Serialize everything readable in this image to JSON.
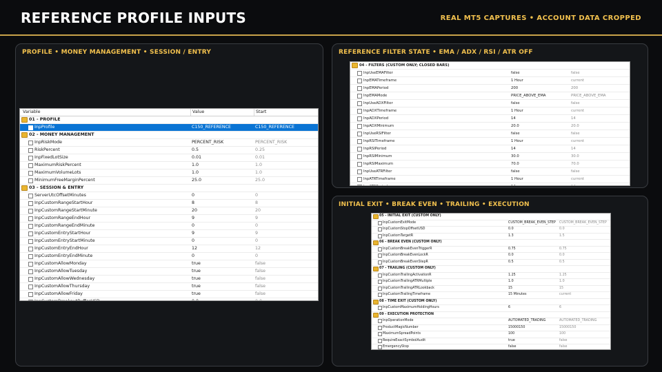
{
  "header": {
    "title": "REFERENCE PROFILE INPUTS",
    "subtitle": "REAL MT5 CAPTURES • ACCOUNT DATA CROPPED"
  },
  "cards": {
    "left_title": "PROFILE • MONEY MANAGEMENT • SESSION / ENTRY",
    "top_right_title": "REFERENCE FILTER STATE • EMA / ADX / RSI / ATR OFF",
    "bottom_right_title": "INITIAL EXIT • BREAK EVEN • TRAILING • EXECUTION"
  },
  "table_left": {
    "headers": [
      "Variable",
      "Value",
      "Start"
    ],
    "rows": [
      {
        "t": "g",
        "n": "01 - PROFILE"
      },
      {
        "t": "r",
        "n": "InpProfile",
        "v": "C150_REFERENCE",
        "s": "C150_REFERENCE",
        "sel": true
      },
      {
        "t": "g",
        "n": "02 - MONEY MANAGEMENT"
      },
      {
        "t": "r",
        "n": "InpRiskMode",
        "v": "PERCENT_RISK",
        "s": "PERCENT_RISK"
      },
      {
        "t": "r",
        "n": "RiskPercent",
        "v": "0.5",
        "s": "0.25"
      },
      {
        "t": "r",
        "n": "InpFixedLotSize",
        "v": "0.01",
        "s": "0.01"
      },
      {
        "t": "r",
        "n": "MaximumRiskPercent",
        "v": "1.0",
        "s": "1.0"
      },
      {
        "t": "r",
        "n": "MaximumVolumeLots",
        "v": "1.0",
        "s": "1.0"
      },
      {
        "t": "r",
        "n": "MinimumFreeMarginPercent",
        "v": "25.0",
        "s": "25.0"
      },
      {
        "t": "g",
        "n": "03 - SESSION & ENTRY"
      },
      {
        "t": "r",
        "n": "ServerUtcOffsetMinutes",
        "v": "0",
        "s": "0"
      },
      {
        "t": "r",
        "n": "InpCustomRangeStartHour",
        "v": "8",
        "s": "8"
      },
      {
        "t": "r",
        "n": "InpCustomRangeStartMinute",
        "v": "20",
        "s": "20"
      },
      {
        "t": "r",
        "n": "InpCustomRangeEndHour",
        "v": "9",
        "s": "9"
      },
      {
        "t": "r",
        "n": "InpCustomRangeEndMinute",
        "v": "0",
        "s": "0"
      },
      {
        "t": "r",
        "n": "InpCustomEntryStartHour",
        "v": "9",
        "s": "9"
      },
      {
        "t": "r",
        "n": "InpCustomEntryStartMinute",
        "v": "0",
        "s": "0"
      },
      {
        "t": "r",
        "n": "InpCustomEntryEndHour",
        "v": "12",
        "s": "12"
      },
      {
        "t": "r",
        "n": "InpCustomEntryEndMinute",
        "v": "0",
        "s": "0"
      },
      {
        "t": "r",
        "n": "InpCustomAllowMonday",
        "v": "true",
        "s": "false"
      },
      {
        "t": "r",
        "n": "InpCustomAllowTuesday",
        "v": "true",
        "s": "false"
      },
      {
        "t": "r",
        "n": "InpCustomAllowWednesday",
        "v": "true",
        "s": "false"
      },
      {
        "t": "r",
        "n": "InpCustomAllowThursday",
        "v": "true",
        "s": "false"
      },
      {
        "t": "r",
        "n": "InpCustomAllowFriday",
        "v": "true",
        "s": "false"
      },
      {
        "t": "r",
        "n": "InpCustomBreakoutBufferUSD",
        "v": "0.0",
        "s": "0.0"
      }
    ]
  },
  "table_top_right": {
    "rows": [
      {
        "t": "g",
        "n": "04 - FILTERS (CUSTOM ONLY; CLOSED BARS)"
      },
      {
        "t": "r",
        "n": "InpUseEMAFilter",
        "v": "false",
        "s": "false"
      },
      {
        "t": "r",
        "n": "InpEMATimeframe",
        "v": "1 Hour",
        "s": "current"
      },
      {
        "t": "r",
        "n": "InpEMAPeriod",
        "v": "200",
        "s": "200"
      },
      {
        "t": "r",
        "n": "InpEMAMode",
        "v": "PRICE_ABOVE_EMA",
        "s": "PRICE_ABOVE_EMA"
      },
      {
        "t": "r",
        "n": "InpUseADXFilter",
        "v": "false",
        "s": "false"
      },
      {
        "t": "r",
        "n": "InpADXTimeframe",
        "v": "1 Hour",
        "s": "current"
      },
      {
        "t": "r",
        "n": "InpADXPeriod",
        "v": "14",
        "s": "14"
      },
      {
        "t": "r",
        "n": "InpADXMinimum",
        "v": "20.0",
        "s": "20.0"
      },
      {
        "t": "r",
        "n": "InpUseRSIFilter",
        "v": "false",
        "s": "false"
      },
      {
        "t": "r",
        "n": "InpRSITimeframe",
        "v": "1 Hour",
        "s": "current"
      },
      {
        "t": "r",
        "n": "InpRSIPeriod",
        "v": "14",
        "s": "14"
      },
      {
        "t": "r",
        "n": "InpRSIMinimum",
        "v": "30.0",
        "s": "30.0"
      },
      {
        "t": "r",
        "n": "InpRSIMaximum",
        "v": "70.0",
        "s": "70.0"
      },
      {
        "t": "r",
        "n": "InpUseATRFilter",
        "v": "false",
        "s": "false"
      },
      {
        "t": "r",
        "n": "InpATRTimeframe",
        "v": "1 Hour",
        "s": "current"
      },
      {
        "t": "r",
        "n": "InpATRPeriod",
        "v": "14",
        "s": "14"
      },
      {
        "t": "r",
        "n": "InpATRMinimumPct",
        "v": "0.0",
        "s": "0.0",
        "sel": true
      }
    ]
  },
  "table_bottom_right": {
    "rows": [
      {
        "t": "g",
        "n": "05 - INITIAL EXIT (CUSTOM ONLY)"
      },
      {
        "t": "r",
        "n": "InpCustomExitMode",
        "v": "CUSTOM_BREAK_EVEN_STEP",
        "s": "CUSTOM_BREAK_EVEN_STEP"
      },
      {
        "t": "r",
        "n": "InpCustomStopOffsetUSD",
        "v": "0.0",
        "s": "0.0"
      },
      {
        "t": "r",
        "n": "InpCustomTargetR",
        "v": "1.3",
        "s": "1.5"
      },
      {
        "t": "g",
        "n": "06 - BREAK EVEN (CUSTOM ONLY)"
      },
      {
        "t": "r",
        "n": "InpCustomBreakEvenTriggerR",
        "v": "0.75",
        "s": "0.75"
      },
      {
        "t": "r",
        "n": "InpCustomBreakEvenLockR",
        "v": "0.0",
        "s": "0.0"
      },
      {
        "t": "r",
        "n": "InpCustomBreakEvenStepR",
        "v": "0.5",
        "s": "0.5"
      },
      {
        "t": "g",
        "n": "07 - TRAILING (CUSTOM ONLY)"
      },
      {
        "t": "r",
        "n": "InpCustomTrailingActivationR",
        "v": "1.25",
        "s": "1.25"
      },
      {
        "t": "r",
        "n": "InpCustomTrailingATRMultiple",
        "v": "1.0",
        "s": "1.0"
      },
      {
        "t": "r",
        "n": "InpCustomTrailingATRLookback",
        "v": "15",
        "s": "15"
      },
      {
        "t": "r",
        "n": "InpCustomTrailingTimeframe",
        "v": "15 Minutes",
        "s": "current"
      },
      {
        "t": "g",
        "n": "08 - TIME EXIT (CUSTOM ONLY)"
      },
      {
        "t": "r",
        "n": "InpCustomMaximumHoldingHours",
        "v": "6",
        "s": "6"
      },
      {
        "t": "g",
        "n": "09 - EXECUTION PROTECTION"
      },
      {
        "t": "r",
        "n": "InpOperationMode",
        "v": "AUTOMATED_TRADING",
        "s": "AUTOMATED_TRADING"
      },
      {
        "t": "r",
        "n": "ProductMagicNumber",
        "v": "15000150",
        "s": "15000150"
      },
      {
        "t": "r",
        "n": "MaximumSpreadPoints",
        "v": "100",
        "s": "100"
      },
      {
        "t": "r",
        "n": "RequireExactSymbolAudit",
        "v": "true",
        "s": "false"
      },
      {
        "t": "r",
        "n": "EmergencyStop",
        "v": "false",
        "s": "false"
      },
      {
        "t": "r",
        "n": "RejectIfExistingForeignPosition",
        "v": "true",
        "s": "false"
      },
      {
        "t": "r",
        "n": "RejectIfSymbolPropertiesChanged",
        "v": "true",
        "s": "false",
        "sel": true
      }
    ]
  },
  "colors": {
    "accent": "#f2c14e",
    "background": "#0b0c0e",
    "card": "#141619",
    "selection": "#0a74d4",
    "folder": "#e9b52f"
  },
  "icons": {
    "group": "folder-icon",
    "row": "checkbox-icon"
  }
}
